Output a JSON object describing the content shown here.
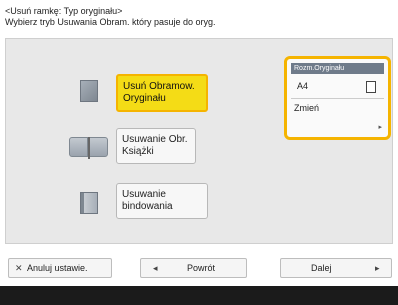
{
  "header": {
    "title": "<Usuń ramkę: Typ oryginału>",
    "subtitle": "Wybierz tryb Usuwania Obram. który pasuje do oryg."
  },
  "options": [
    {
      "label_line1": "Usuń Obramow.",
      "label_line2": "Oryginału",
      "selected": true,
      "icon": "original-sheet-icon"
    },
    {
      "label_line1": "Usuwanie Obr.",
      "label_line2": "Książki",
      "selected": false,
      "icon": "open-book-icon"
    },
    {
      "label_line1": "Usuwanie",
      "label_line2": "bindowania",
      "selected": false,
      "icon": "binding-icon"
    }
  ],
  "original_size": {
    "title": "Rozm.Oryginału",
    "value": "A4",
    "orientation_icon": "portrait-page-icon",
    "change_label": "Zmień"
  },
  "footer": {
    "cancel_label": "Anuluj ustawie.",
    "back_label": "Powrót",
    "next_label": "Dalej"
  },
  "colors": {
    "selected_fill": "#f4dc16",
    "highlight_border": "#f5b400",
    "panel_bg": "#e8e8e8",
    "bottom_bar": "#1b1b1b"
  }
}
